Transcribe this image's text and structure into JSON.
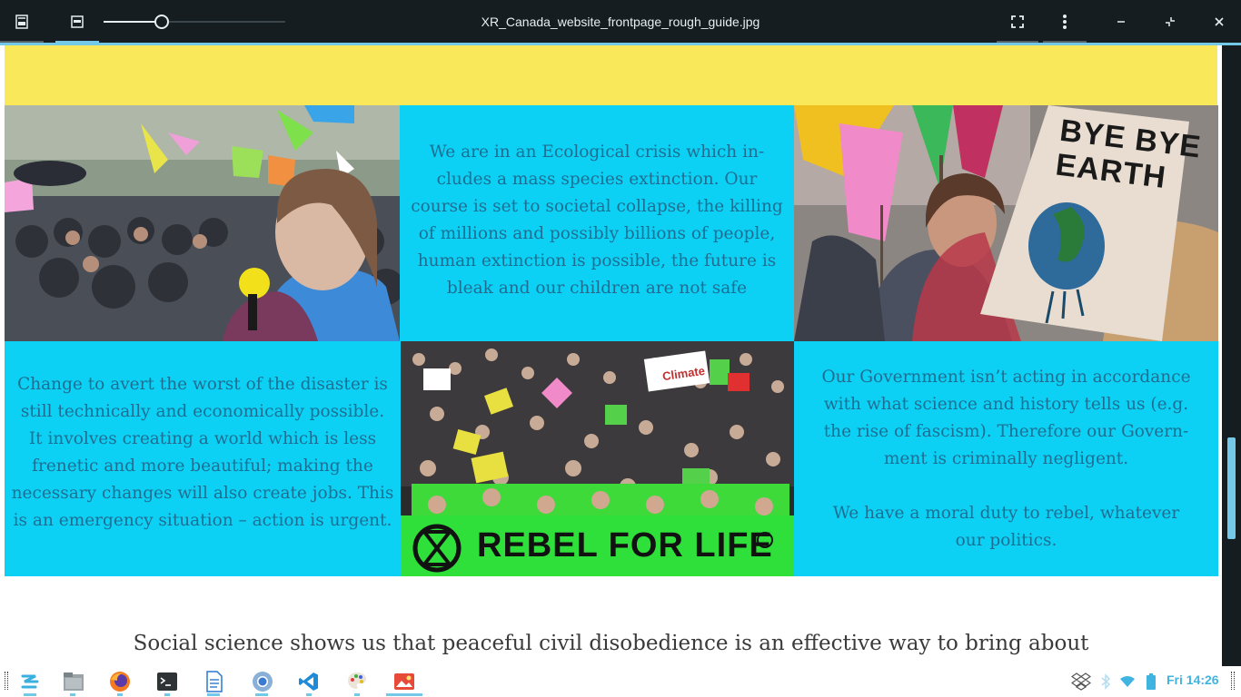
{
  "window": {
    "title": "XR_Canada_website_frontpage_rough_guide.jpg",
    "zoom_slider_fraction": 0.31
  },
  "content": {
    "top_center_text": "We are in an Ecological crisis which in-\ncludes a mass species extinction.  Our\ncourse is set to societal collapse, the killing\nof millions and possibly billions of people,\nhuman extinction is possible, the future is\nbleak and our children are not safe",
    "bottom_left_text": "Change to avert the worst of the disaster is\nstill technically and economically possible.\nIt involves creating a world which is less\nfrenetic and more beautiful; making the\nnecessary changes will also create jobs. This\nis an emergency situation – action is urgent.",
    "bottom_right_text_1": "Our Government isn’t acting in accordance\nwith what science and history tells us (e.g.\nthe rise of fascism). Therefore our Govern-\nment is criminally negligent.",
    "bottom_right_text_2": "We have a moral duty to rebel, whatever\nour politics.",
    "sign_bye_earth": "BYE BYE\nEARTH",
    "banner_text": "REBEL FOR LIFE",
    "sign_climate": "Climate",
    "bottom_heading": "Social science shows us that peaceful civil disobedience is an effective way to bring about"
  },
  "taskbar": {
    "clock": "Fri 14:26",
    "apps": [
      "zorin-menu-icon",
      "files-icon",
      "firefox-icon",
      "terminal-icon",
      "document-icon",
      "chromium-icon",
      "vscode-icon",
      "paint-icon",
      "image-viewer-icon"
    ]
  },
  "colors": {
    "accent": "#74c9e8",
    "panel_blue": "#0cd1f4",
    "banner_yellow": "#f9e85a",
    "text_blue": "#1e6e93"
  }
}
